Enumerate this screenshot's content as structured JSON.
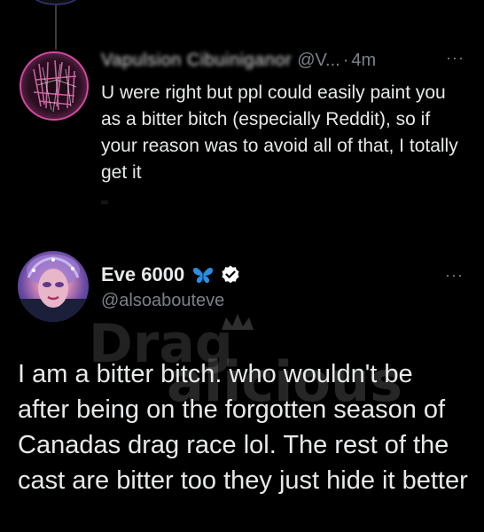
{
  "reply": {
    "name": "Vapulsion Cibuiniganor",
    "handle": "@V...",
    "separator": "·",
    "time": "4m",
    "more": "···",
    "text": "U were right but ppl could easily paint you as a bitter bitch (especially Reddit), so if your reason was to avoid all of that, I totally get it"
  },
  "tweet": {
    "name": "Eve 6000",
    "handle": "@alsoabouteve",
    "more": "···",
    "text": "I am a bitter bitch. who wouldn't be after being on the forgotten season of Canadas drag race lol. The rest of the cast are bitter too they just hide it better"
  },
  "watermark": {
    "text": "DragAlicious"
  },
  "colors": {
    "background": "#000000",
    "text": "#e7e9ea",
    "secondary": "#7b8188",
    "verified": "#ffffff",
    "butterfly": "#2a8fe0"
  },
  "icons": {
    "butterfly": "butterfly-emoji-icon",
    "verified": "verified-badge-icon",
    "more": "more-horizontal-icon"
  }
}
